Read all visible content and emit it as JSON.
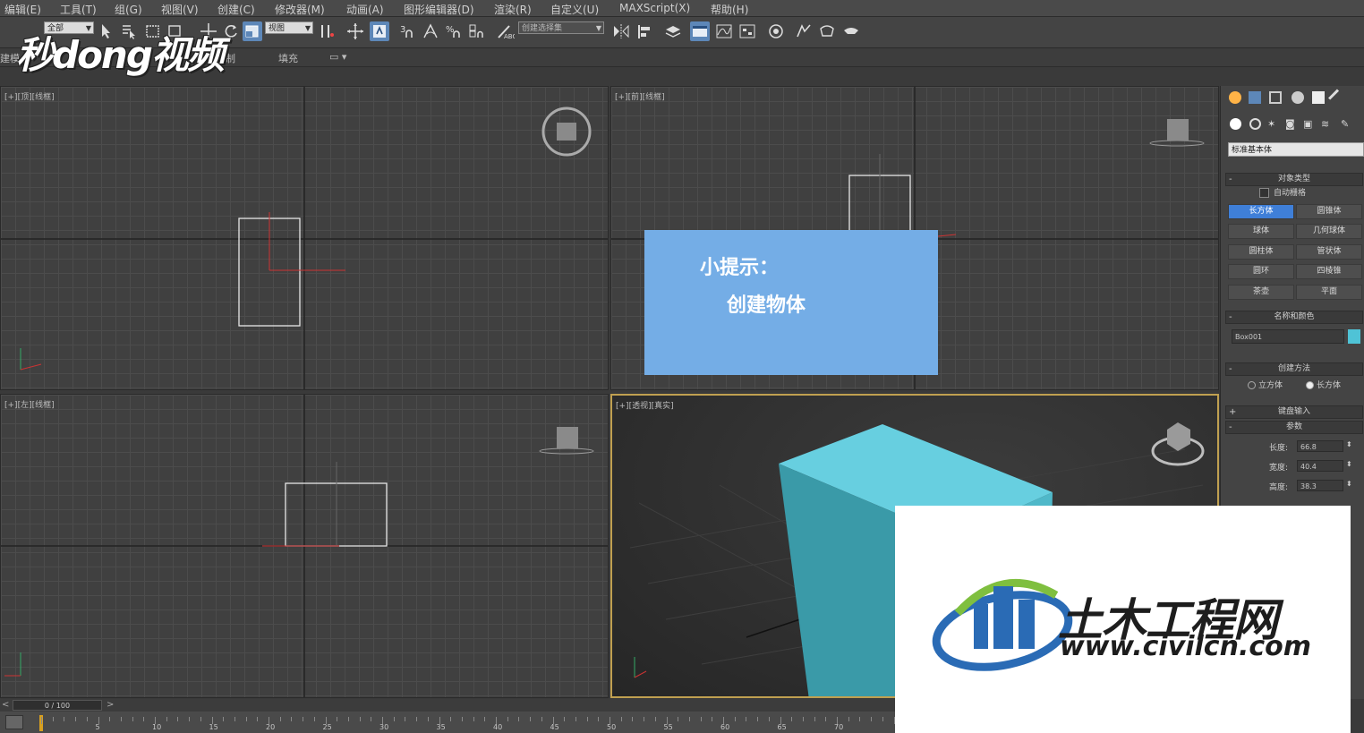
{
  "menu": {
    "items": [
      "编辑(E)",
      "工具(T)",
      "组(G)",
      "视图(V)",
      "创建(C)",
      "修改器(M)",
      "动画(A)",
      "图形编辑器(D)",
      "渲染(R)",
      "自定义(U)",
      "MAXScript(X)",
      "帮助(H)"
    ]
  },
  "toolbar": {
    "selection_filter": "全部",
    "ref_coord": "视图",
    "named_selection": "创建选择集"
  },
  "ribbon": {
    "label_model": "建模",
    "label_draw": "制",
    "label_fill": "填充"
  },
  "watermark_text": "秒dong视频",
  "viewports": {
    "top": "[+][顶][线框]",
    "front": "[+][前][线框]",
    "left": "[+][左][线框]",
    "persp": "[+][透视][真实]"
  },
  "tip": {
    "title": "小提示：",
    "body": "创建物体"
  },
  "command_panel": {
    "category": "标准基本体",
    "sec_object_type": "对象类型",
    "autogrid": "自动栅格",
    "objects": [
      "长方体",
      "圆锥体",
      "球体",
      "几何球体",
      "圆柱体",
      "管状体",
      "圆环",
      "四棱锥",
      "茶壶",
      "平面"
    ],
    "sec_name_color": "名称和颜色",
    "object_name": "Box001",
    "sec_creation": "创建方法",
    "method_cube": "立方体",
    "method_box": "长方体",
    "sec_keyboard": "键盘输入",
    "sec_params": "参数",
    "length_label": "长度:",
    "length_value": "66.8",
    "width_label": "宽度:",
    "width_value": "40.4",
    "height_label": "高度:",
    "height_value": "38.3",
    "object_color": "#4fc3d6"
  },
  "timeline": {
    "frame": "0 / 100",
    "ticks": [
      "5",
      "10",
      "15",
      "20",
      "25",
      "30",
      "35",
      "40",
      "45",
      "50",
      "55",
      "60",
      "65",
      "70"
    ]
  },
  "logo": {
    "cn": "土木工程网",
    "url": "www.civilcn.com"
  },
  "colors": {
    "accent": "#5d87b8",
    "selected_button": "#3f7fd8",
    "box": "#4fc3d6",
    "tip_bg": "#74ade6"
  }
}
